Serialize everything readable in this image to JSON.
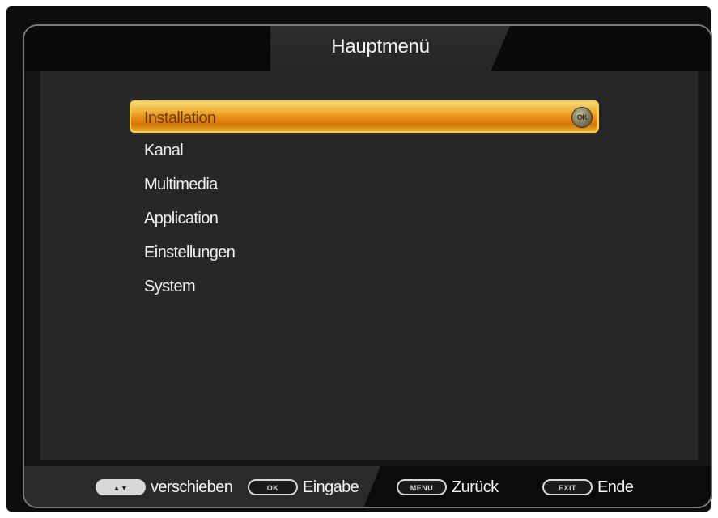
{
  "header": {
    "title": "Hauptmenü"
  },
  "menu": {
    "items": [
      {
        "label": "Installation",
        "selected": true
      },
      {
        "label": "Kanal"
      },
      {
        "label": "Multimedia"
      },
      {
        "label": "Application"
      },
      {
        "label": "Einstellungen"
      },
      {
        "label": "System"
      }
    ],
    "ok_badge": "OK"
  },
  "footer": {
    "hints": [
      {
        "key": "▲▼",
        "text": "verschieben"
      },
      {
        "key": "OK",
        "text": "Eingabe"
      },
      {
        "key": "MENU",
        "text": "Zurück"
      },
      {
        "key": "EXIT",
        "text": "Ende"
      }
    ]
  },
  "colors": {
    "highlight": "#e88a14",
    "highlight_border": "#f7d24a",
    "background": "#272727",
    "text": "#f0f0f0"
  }
}
